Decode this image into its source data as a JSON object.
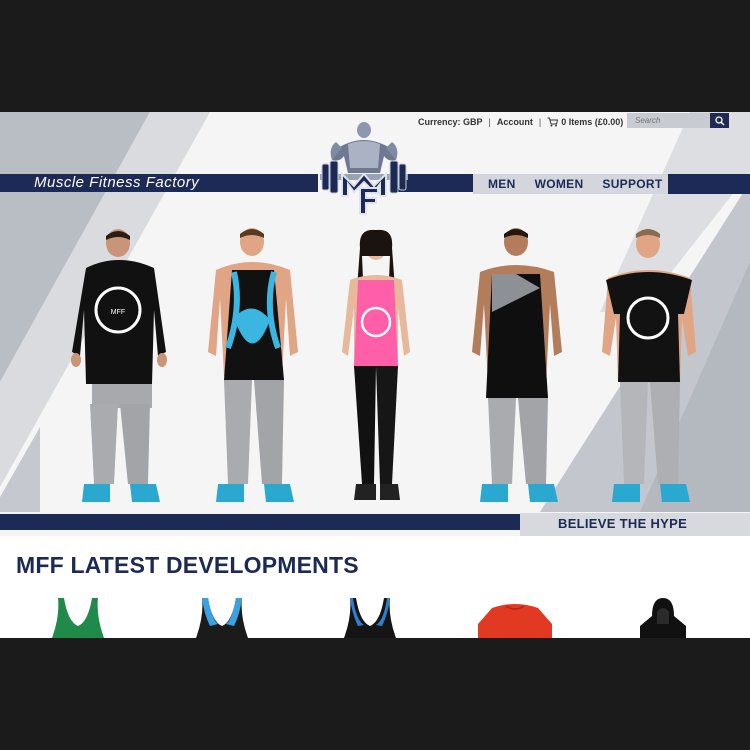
{
  "topbar": {
    "currency": "Currency: GBP",
    "account": "Account",
    "cart": "0 Items (£0.00)",
    "search_placeholder": "Search"
  },
  "brand": {
    "name": "Muscle Fitness Factory",
    "logo_text": "MF"
  },
  "nav": {
    "items": [
      "MEN",
      "WOMEN",
      "SUPPORT"
    ]
  },
  "hero": {
    "tagline": "BELIEVE THE HYPE"
  },
  "section": {
    "title": "MFF LATEST DEVELOPMENTS"
  },
  "colors": {
    "navy": "#1c2a55",
    "light_grey": "#d3d6dc",
    "cyan": "#3bb6e0",
    "pink": "#ff5fa8",
    "red": "#e23a22",
    "green": "#1f8a4a"
  },
  "models": [
    {
      "outfit": "black hoodie, grey joggers"
    },
    {
      "outfit": "black/blue stringer vest, grey joggers"
    },
    {
      "outfit": "pink vest, black leggings"
    },
    {
      "outfit": "black/grey vest, grey joggers"
    },
    {
      "outfit": "black t-shirt, grey joggers"
    }
  ],
  "products": [
    {
      "name": "green stringer"
    },
    {
      "name": "blue stringer"
    },
    {
      "name": "black/blue stringer"
    },
    {
      "name": "red t-shirt"
    },
    {
      "name": "black hoodie"
    }
  ]
}
